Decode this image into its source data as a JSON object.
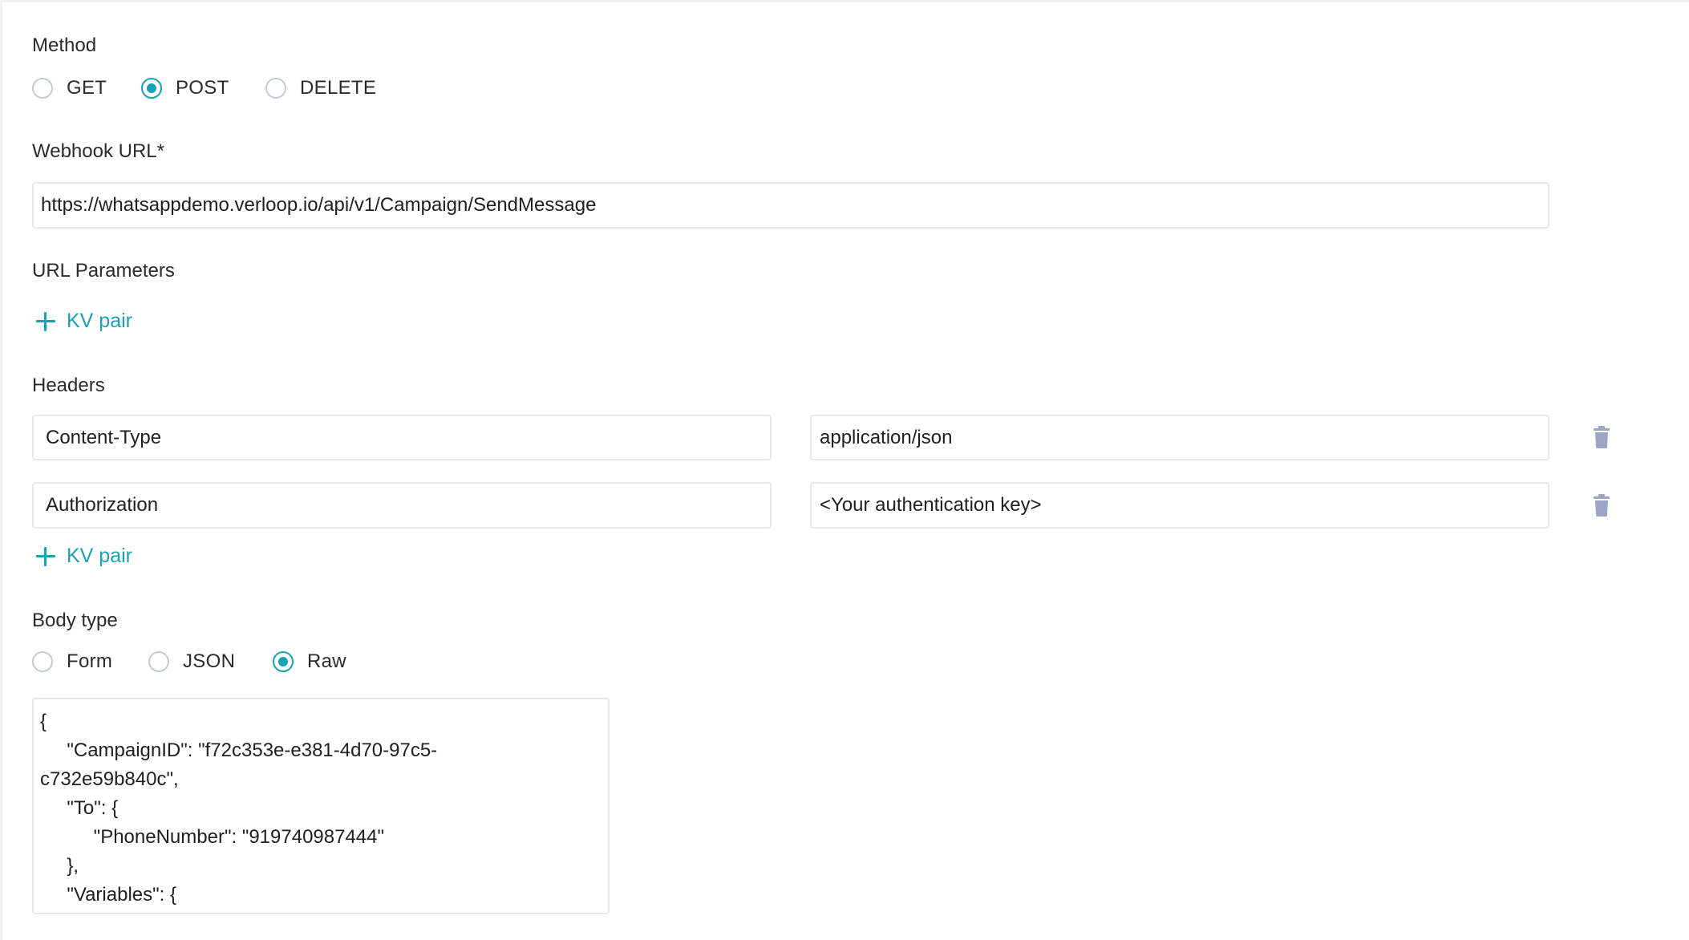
{
  "method": {
    "label": "Method",
    "options": [
      "GET",
      "POST",
      "DELETE"
    ],
    "selected": "POST"
  },
  "webhook": {
    "label": "Webhook URL*",
    "value": "https://whatsappdemo.verloop.io/api/v1/Campaign/SendMessage"
  },
  "url_params": {
    "label": "URL Parameters",
    "add_label": "KV pair"
  },
  "headers": {
    "label": "Headers",
    "rows": [
      {
        "key": "Content-Type",
        "value": "application/json"
      },
      {
        "key": "Authorization",
        "value": "<Your authentication key>"
      }
    ],
    "add_label": "KV pair"
  },
  "body_type": {
    "label": "Body type",
    "options": [
      "Form",
      "JSON",
      "Raw"
    ],
    "selected": "Raw"
  },
  "body": {
    "lines": [
      "{",
      "     \"CampaignID\": \"f72c353e-e381-4d70-97c5-",
      "c732e59b840c\",",
      "     \"To\": {",
      "          \"PhoneNumber\": \"919740987444\"",
      "     },",
      "     \"Variables\": {"
    ]
  },
  "colors": {
    "accent": "#17a2b8",
    "trash": "#9aa6c4",
    "border": "#e4e7eb"
  },
  "icons": {
    "add": "plus-icon",
    "delete": "trash-icon"
  }
}
